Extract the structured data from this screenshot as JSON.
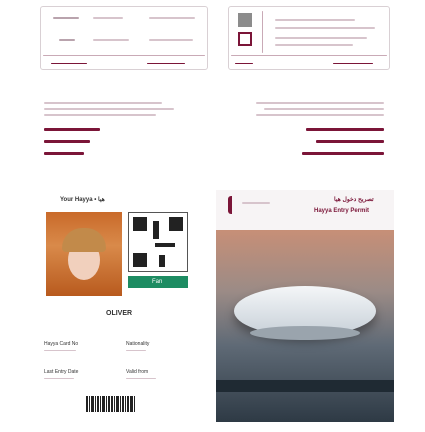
{
  "top_left_card": {
    "rows": [
      {
        "left": "",
        "mid": "",
        "right": ""
      },
      {
        "left": "",
        "mid": "",
        "right": ""
      }
    ]
  },
  "left_middle": {
    "title_lines": [
      "",
      "",
      ""
    ],
    "arabic_lines": [
      "",
      "",
      ""
    ]
  },
  "right_middle": {
    "title_lines": [
      "",
      "",
      ""
    ]
  },
  "fan_card": {
    "header": "Your Hayya • هيا",
    "role": "Fan",
    "name": "OLIVER",
    "fields": [
      {
        "label": "Hayya Card No",
        "value": ""
      },
      {
        "label": "Nationality",
        "value": ""
      },
      {
        "label": "Last Entry Date",
        "value": ""
      },
      {
        "label": "Valid from",
        "value": ""
      }
    ]
  },
  "permit_card": {
    "arabic_title": "تصريح دخول هيا",
    "title": "Hayya Entry Permit"
  },
  "colors": {
    "maroon": "#7b1538",
    "green": "#1d8c62"
  }
}
